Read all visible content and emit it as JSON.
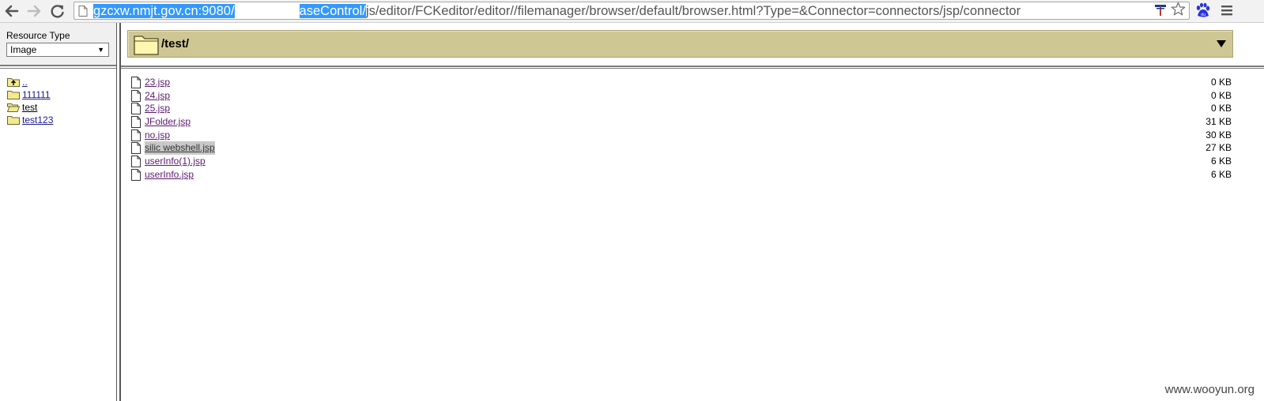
{
  "browser": {
    "url_selected_start": "gzcxw.nmjt.gov.cn:9080/",
    "url_selected_end": "aseControl/",
    "url_rest": "js/editor/FCKeditor/editor//filemanager/browser/default/browser.html?Type=&Connector=connectors/jsp/connector",
    "icons": [
      "back-arrow",
      "forward-arrow",
      "reload",
      "page",
      "extension",
      "star",
      "baidu-paw",
      "menu"
    ]
  },
  "resource": {
    "label": "Resource Type",
    "selected": "Image"
  },
  "folders": [
    {
      "name": "..",
      "icon": "folder-up"
    },
    {
      "name": "111111",
      "icon": "folder"
    },
    {
      "name": "test",
      "icon": "folder-open"
    },
    {
      "name": "test123",
      "icon": "folder"
    }
  ],
  "current_path": "/test/",
  "files": [
    {
      "name": "23.jsp",
      "size": "0 KB"
    },
    {
      "name": "24.jsp",
      "size": "0 KB"
    },
    {
      "name": "25.jsp",
      "size": "0 KB"
    },
    {
      "name": "JFolder.jsp",
      "size": "31 KB"
    },
    {
      "name": "no.jsp",
      "size": "30 KB"
    },
    {
      "name": "silic webshell.jsp",
      "size": "27 KB",
      "highlighted": true
    },
    {
      "name": "userInfo(1).jsp",
      "size": "6 KB"
    },
    {
      "name": "userInfo.jsp",
      "size": "6 KB"
    }
  ],
  "colors": {
    "header_bg": "#cfc793",
    "url_selection": "#3399ff",
    "link": "#5a1a6e"
  },
  "watermark": "www.wooyun.org"
}
